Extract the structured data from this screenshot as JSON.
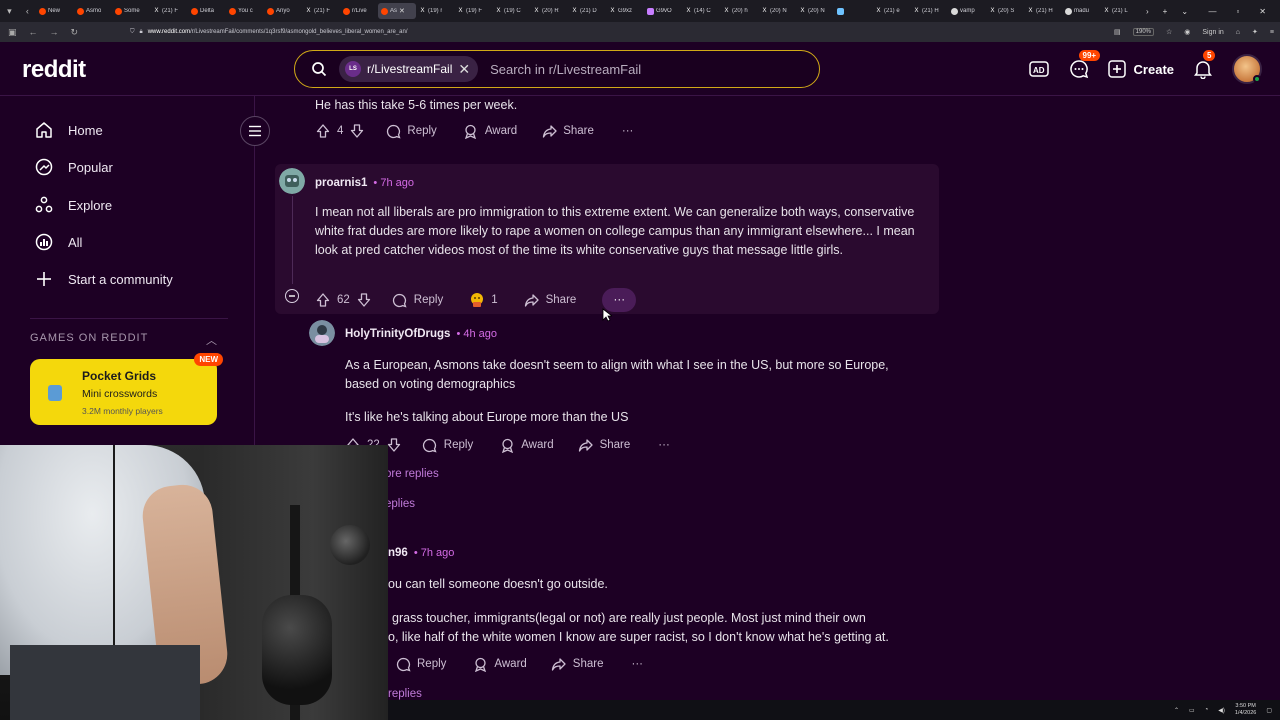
{
  "browser": {
    "tabs": [
      {
        "label": "New",
        "icon": "reddit-icon"
      },
      {
        "label": "Asmo",
        "icon": "reddit-icon"
      },
      {
        "label": "Some",
        "icon": "reddit-icon"
      },
      {
        "label": "(21) F",
        "icon": "x-icon"
      },
      {
        "label": "Delta",
        "icon": "reddit-icon"
      },
      {
        "label": "You c",
        "icon": "reddit-icon"
      },
      {
        "label": "Anyo",
        "icon": "reddit-icon"
      },
      {
        "label": "(21) F",
        "icon": "x-icon"
      },
      {
        "label": "r/Live",
        "icon": "reddit-icon"
      },
      {
        "label": "As",
        "icon": "reddit-icon",
        "active": true
      },
      {
        "label": "(19) r",
        "icon": "x-icon"
      },
      {
        "label": "(19) F",
        "icon": "x-icon"
      },
      {
        "label": "(19) C",
        "icon": "x-icon"
      },
      {
        "label": "(20) R",
        "icon": "x-icon"
      },
      {
        "label": "(21) D",
        "icon": "x-icon"
      },
      {
        "label": "G9xz",
        "icon": "x-icon"
      },
      {
        "label": "G9vO",
        "icon": "image-icon"
      },
      {
        "label": "(14) C",
        "icon": "x-icon"
      },
      {
        "label": "(20) h",
        "icon": "x-icon"
      },
      {
        "label": "(20) N",
        "icon": "x-icon"
      },
      {
        "label": "(20) N",
        "icon": "x-icon"
      },
      {
        "label": "",
        "icon": "image-icon-blue"
      },
      {
        "label": "(21) e",
        "icon": "x-icon"
      },
      {
        "label": "(21) H",
        "icon": "x-icon"
      },
      {
        "label": "vamp",
        "icon": "globe-icon"
      },
      {
        "label": "(20) S",
        "icon": "x-icon"
      },
      {
        "label": "(21) H",
        "icon": "x-icon"
      },
      {
        "label": "madu",
        "icon": "globe-icon"
      },
      {
        "label": "(21) L",
        "icon": "x-icon"
      }
    ],
    "url_host": "www.reddit.com",
    "url_path": "/r/LivestreamFail/comments/1q3rsf9/asmongold_believes_liberal_women_are_an/",
    "zoom": "190%",
    "signin": "Sign in"
  },
  "header": {
    "logo": "reddit",
    "search_chip": "r/LivestreamFail",
    "search_chip_avatar": "LS",
    "search_placeholder": "Search in r/LivestreamFail",
    "chat_badge": "99+",
    "notif_badge": "5",
    "create_label": "Create"
  },
  "sidebar": {
    "items": [
      {
        "label": "Home"
      },
      {
        "label": "Popular"
      },
      {
        "label": "Explore"
      },
      {
        "label": "All"
      },
      {
        "label": "Start a community"
      }
    ],
    "games_heading": "GAMES ON REDDIT",
    "game": {
      "name": "Pocket Grids",
      "subtitle": "Mini crosswords",
      "players": "3.2M monthly players",
      "badge": "NEW"
    }
  },
  "comments": {
    "c0": {
      "text": "He has this take 5-6 times per week.",
      "votes": "4",
      "reply": "Reply",
      "award": "Award",
      "share": "Share"
    },
    "c1": {
      "author": "proarnis1",
      "time": "• 7h ago",
      "text": "I mean not all liberals are pro immigration to this extreme extent. We can generalize both ways, conservative white frat dudes are more likely to rape a women on college campus than any immigrant elsewhere... I mean look at pred catcher videos most of the time its white conservative guys that message little girls.",
      "votes": "62",
      "reply": "Reply",
      "award_count": "1",
      "share": "Share"
    },
    "c2": {
      "author": "HolyTrinityOfDrugs",
      "time": "• 4h ago",
      "text1": "As a European, Asmons take doesn't seem to align with what I see in the US, but more so Europe, based on voting demographics",
      "text2": "It's like he's talking about Europe more than the US",
      "votes": "22",
      "reply": "Reply",
      "award": "Award",
      "share": "Share"
    },
    "more_replies_1": "ore replies",
    "more_replies_2": "eplies",
    "c3": {
      "author": "n96",
      "time": "• 7h ago",
      "text1": "ou can tell someone doesn't go outside.",
      "text2": "grass toucher, immigrants(legal or not) are really just people. Most just mind their own",
      "text3": "o, like half of the white women I know are super racist, so I don't know what he's getting at.",
      "reply": "Reply",
      "award": "Award",
      "share": "Share"
    },
    "more_replies_3": "replies"
  },
  "taskbar": {
    "time": "3:50 PM",
    "date": "1/4/2026"
  },
  "colors": {
    "background": "#1d0024",
    "accent": "#ff4500",
    "time_link": "#d46be5",
    "search_border": "#d1a917"
  }
}
